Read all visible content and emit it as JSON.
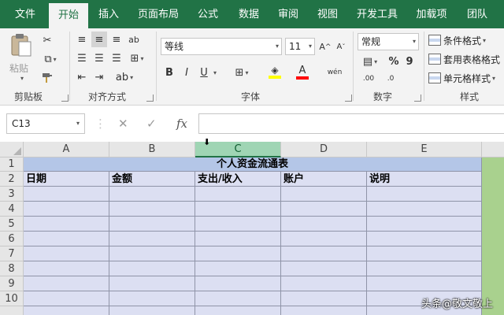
{
  "menu": {
    "tabs": [
      "文件",
      "开始",
      "插入",
      "页面布局",
      "公式",
      "数据",
      "审阅",
      "视图",
      "开发工具",
      "加载项",
      "团队"
    ]
  },
  "ribbon": {
    "clipboard": {
      "paste_label": "粘贴",
      "group_label": "剪贴板"
    },
    "alignment": {
      "group_label": "对齐方式"
    },
    "font": {
      "name": "等线",
      "size": "11",
      "group_label": "字体",
      "bold": "B",
      "italic": "I",
      "underline": "U",
      "wen_label": "wén"
    },
    "number": {
      "format": "常规",
      "group_label": "数字",
      "percent": "%",
      "comma": "9"
    },
    "styles": {
      "conditional": "条件格式",
      "table_format": "套用表格格式",
      "cell_styles": "单元格样式",
      "group_label": "样式"
    },
    "colors": {
      "fill": "#ffff00",
      "font": "#ff0000"
    }
  },
  "formula_bar": {
    "name_box": "C13",
    "cancel": "✕",
    "enter": "✓",
    "fx": "fx",
    "value": ""
  },
  "sheet": {
    "columns": [
      "A",
      "B",
      "C",
      "D",
      "E"
    ],
    "selected_column": "C",
    "rows": [
      "1",
      "2",
      "3",
      "4",
      "5",
      "6",
      "7",
      "8",
      "9",
      "10"
    ],
    "title": "个人资金流通表",
    "headers": [
      "日期",
      "金额",
      "支出/收入",
      "账户",
      "说明"
    ]
  },
  "watermark": "头条@敬文敬上"
}
